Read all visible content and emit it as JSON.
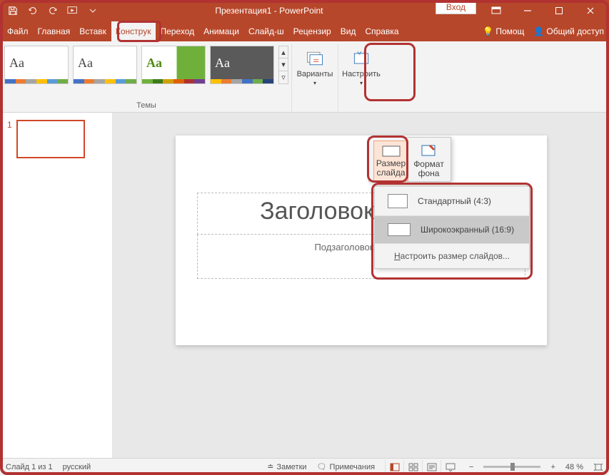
{
  "titlebar": {
    "title": "Презентация1 - PowerPoint",
    "login": "Вход"
  },
  "tabs": {
    "file": "Файл",
    "home": "Главная",
    "insert": "Вставк",
    "design": "Конструк",
    "transitions": "Переход",
    "animations": "Анимаци",
    "slideshow": "Слайд-ш",
    "review": "Рецензир",
    "view": "Вид",
    "help": "Справка",
    "tellme": "Помощ",
    "share": "Общий доступ"
  },
  "ribbon": {
    "themes_label": "Темы",
    "variants_btn": "Варианты",
    "customize_btn": "Настроить"
  },
  "popover1": {
    "size": "Размер слайда",
    "format": "Формат фона"
  },
  "popover2": {
    "standard": "Стандартный (4:3)",
    "widescreen": "Широкоэкранный (16:9)",
    "custom_prefix": "Н",
    "custom_rest": "астроить размер слайдов..."
  },
  "slide": {
    "num": "1",
    "title_ph": "Заголовок слайда",
    "subtitle_ph": "Подзаголовок слайда"
  },
  "statusbar": {
    "slide_info": "Слайд 1 из 1",
    "lang": "русский",
    "notes": "Заметки",
    "comments": "Примечания",
    "zoom": "48 %"
  },
  "colors": {
    "accent": "#b7472a"
  }
}
